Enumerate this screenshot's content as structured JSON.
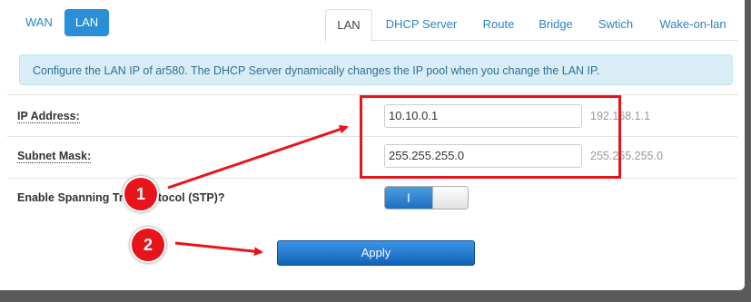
{
  "left_tabs": [
    {
      "label": "WAN",
      "active": false
    },
    {
      "label": "LAN",
      "active": true
    }
  ],
  "right_tabs": [
    {
      "label": "LAN",
      "active": true
    },
    {
      "label": "DHCP Server",
      "active": false
    },
    {
      "label": "Route",
      "active": false
    },
    {
      "label": "Bridge",
      "active": false
    },
    {
      "label": "Swtich",
      "active": false
    },
    {
      "label": "Wake-on-lan",
      "active": false
    }
  ],
  "info": "Configure the LAN IP of ar580. The DHCP Server dynamically changes the IP pool when you change the LAN IP.",
  "fields": {
    "ip": {
      "label": "IP Address:",
      "value": "10.10.0.1",
      "hint": "192.168.1.1"
    },
    "mask": {
      "label": "Subnet Mask:",
      "value": "255.255.255.0",
      "hint": "255.255.255.0"
    },
    "stp": {
      "label": "Enable Spanning Tree Protocol (STP)?",
      "on_glyph": "I",
      "enabled": true
    }
  },
  "apply_label": "Apply",
  "annotations": {
    "marker1": "1",
    "marker2": "2",
    "color": "#e8141c"
  }
}
